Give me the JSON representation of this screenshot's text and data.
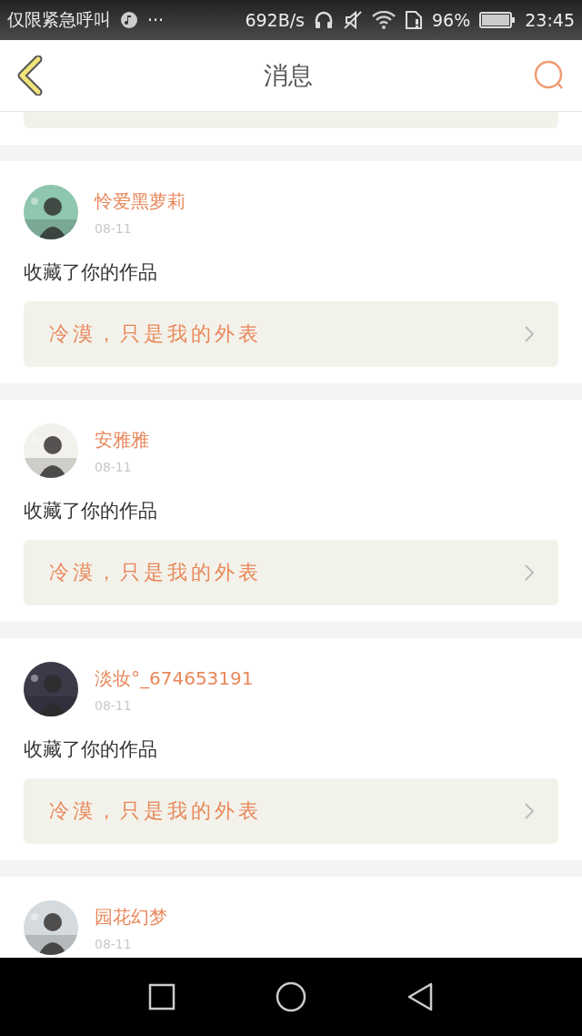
{
  "status_bar": {
    "carrier": "仅限紧急呼叫",
    "more": "···",
    "speed": "692B/s",
    "battery": "96%",
    "time": "23:45"
  },
  "header": {
    "title": "消息"
  },
  "messages": [
    {
      "name": "怜爱黑萝莉",
      "date": "08-11",
      "action": "收藏了你的作品",
      "work": "冷漠，只是我的外表"
    },
    {
      "name": "安雅雅",
      "date": "08-11",
      "action": "收藏了你的作品",
      "work": "冷漠，只是我的外表"
    },
    {
      "name": "淡妆°_674653191",
      "date": "08-11",
      "action": "收藏了你的作品",
      "work": "冷漠，只是我的外表"
    },
    {
      "name": "园花幻梦",
      "date": "08-11"
    }
  ]
}
